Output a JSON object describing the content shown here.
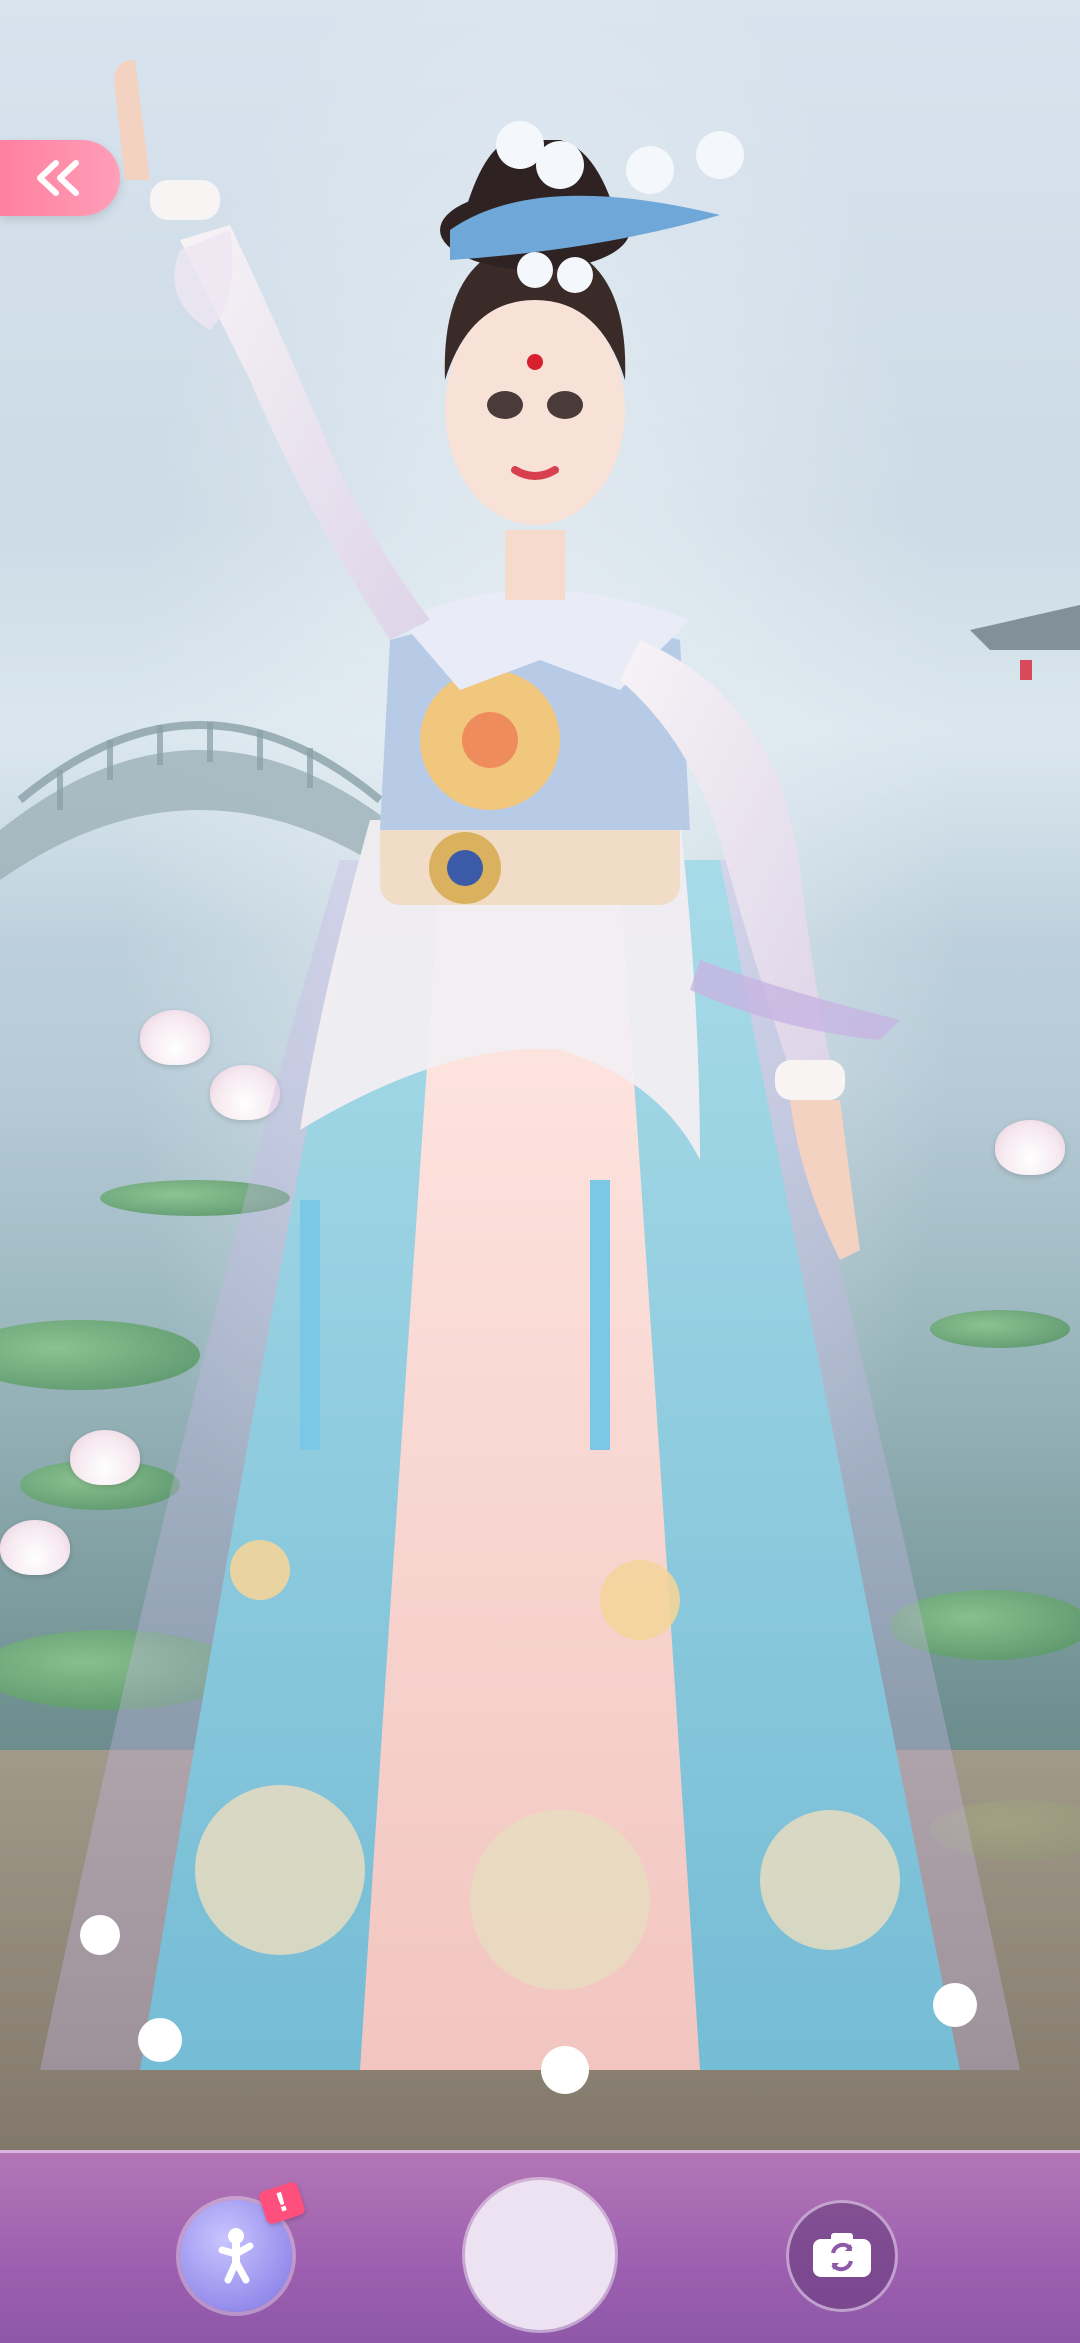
{
  "screen": {
    "type": "dress-up photo mode"
  },
  "controls": {
    "back_icon": "double-chevron-left-icon",
    "pose_icon": "person-pose-icon",
    "pose_badge": "!",
    "shutter_icon": "shutter-circle",
    "flip_camera_icon": "camera-switch-icon"
  },
  "colors": {
    "back_button": "#ff8aa8",
    "bottom_bar": "#9d5fb0",
    "pose_button": "#8f86ea",
    "badge": "#ff4f7d",
    "shutter": "#ece2f2"
  }
}
